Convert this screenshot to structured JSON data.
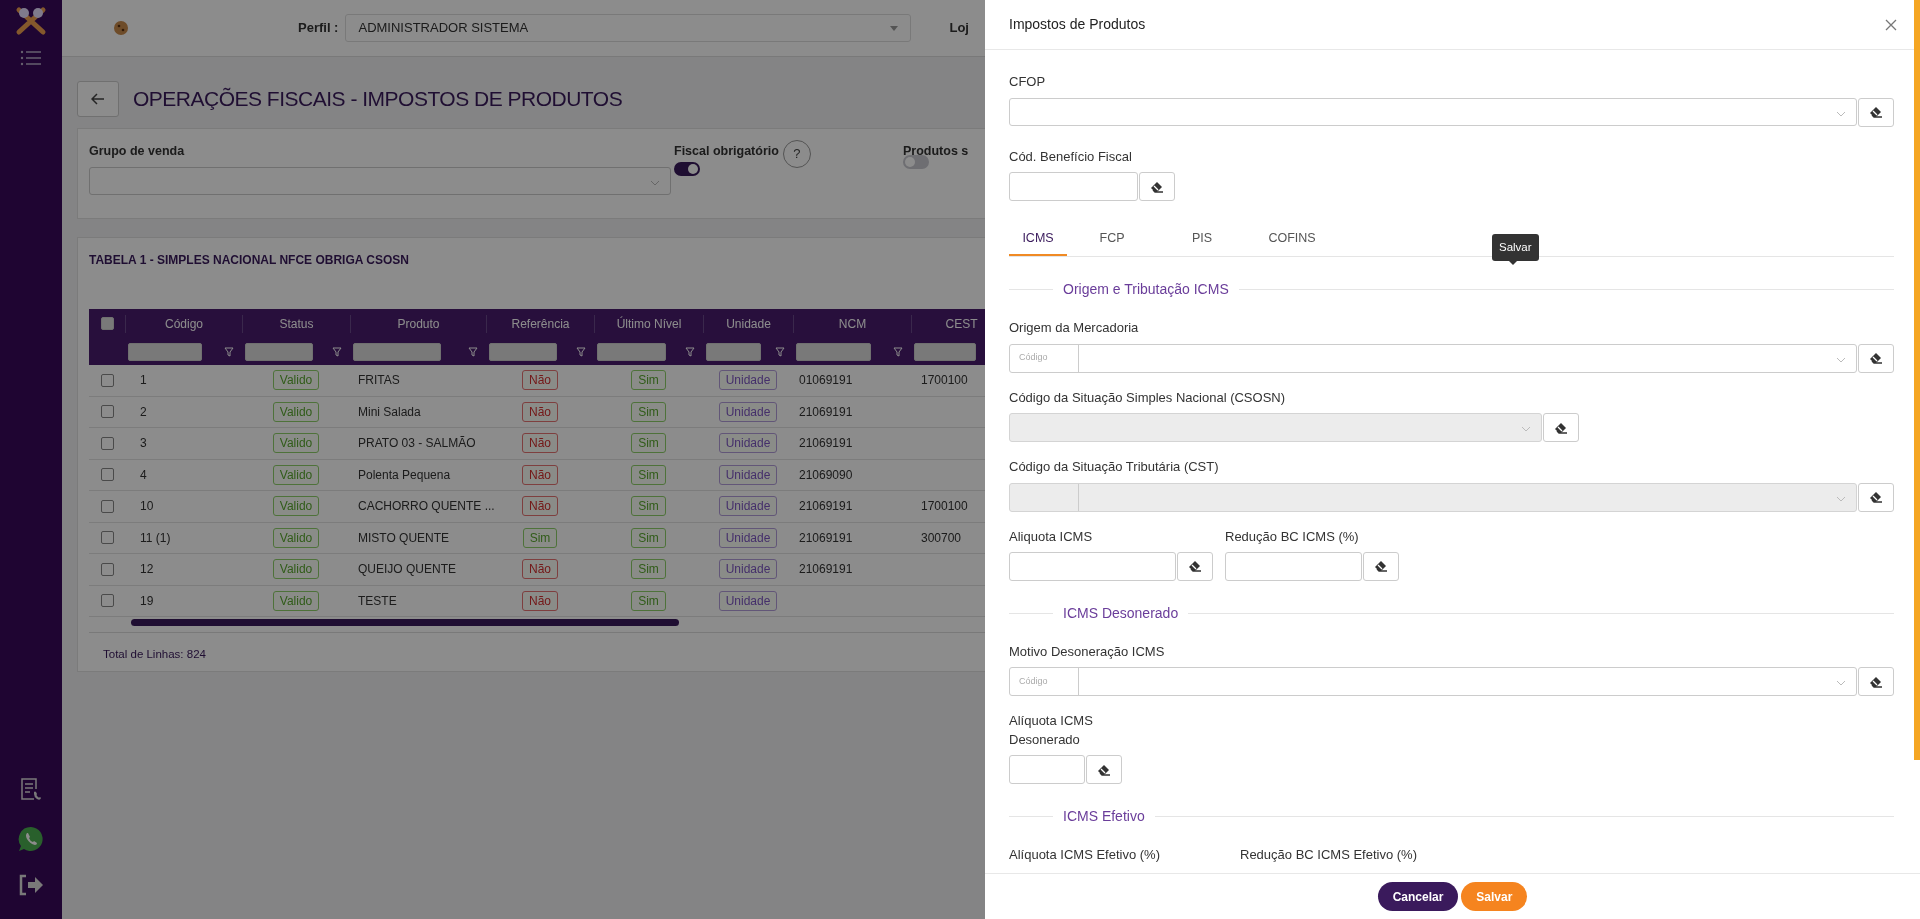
{
  "header": {
    "profile_label": "Perfil :",
    "profile_value": "ADMINISTRADOR SISTEMA",
    "store_label": "Loj"
  },
  "page": {
    "title": "OPERAÇÕES FISCAIS - IMPOSTOS DE PRODUTOS"
  },
  "filters": [
    {
      "kind": "select",
      "label": "Grupo de venda"
    },
    {
      "kind": "toggle",
      "label": "Fiscal obrigatório",
      "on": true,
      "help": "?"
    },
    {
      "kind": "toggle",
      "label": "Produtos s",
      "on": false
    }
  ],
  "table": {
    "title": "TABELA 1 - SIMPLES NACIONAL NFCE OBRIGA CSOSN",
    "header_checked": false,
    "columns": [
      "Código",
      "Status",
      "Produto",
      "Referência",
      "Último Nível",
      "Unidade",
      "NCM",
      "CEST"
    ],
    "rows": [
      {
        "checked": false,
        "codigo": "1",
        "status": "Valido",
        "produto": "FRITAS",
        "referencia": {
          "text": "Não",
          "positive": false
        },
        "ultimo_nivel": "Sim",
        "unidade": "Unidade",
        "ncm": "01069191",
        "cest": "1700100"
      },
      {
        "checked": false,
        "codigo": "2",
        "status": "Valido",
        "produto": "Mini Salada",
        "referencia": {
          "text": "Não",
          "positive": false
        },
        "ultimo_nivel": "Sim",
        "unidade": "Unidade",
        "ncm": "21069191",
        "cest": ""
      },
      {
        "checked": false,
        "codigo": "3",
        "status": "Valido",
        "produto": "PRATO 03 - SALMÃO",
        "referencia": {
          "text": "Não",
          "positive": false
        },
        "ultimo_nivel": "Sim",
        "unidade": "Unidade",
        "ncm": "21069191",
        "cest": ""
      },
      {
        "checked": false,
        "codigo": "4",
        "status": "Valido",
        "produto": "Polenta Pequena",
        "referencia": {
          "text": "Não",
          "positive": false
        },
        "ultimo_nivel": "Sim",
        "unidade": "Unidade",
        "ncm": "21069090",
        "cest": ""
      },
      {
        "checked": false,
        "codigo": "10",
        "status": "Valido",
        "produto": "CACHORRO QUENTE ...",
        "referencia": {
          "text": "Não",
          "positive": false
        },
        "ultimo_nivel": "Sim",
        "unidade": "Unidade",
        "ncm": "21069191",
        "cest": "1700100"
      },
      {
        "checked": false,
        "codigo": "11 (1)",
        "status": "Valido",
        "produto": "MISTO QUENTE",
        "referencia": {
          "text": "Sim",
          "positive": true
        },
        "ultimo_nivel": "Sim",
        "unidade": "Unidade",
        "ncm": "21069191",
        "cest": "300700"
      },
      {
        "checked": false,
        "codigo": "12",
        "status": "Valido",
        "produto": "QUEIJO QUENTE",
        "referencia": {
          "text": "Não",
          "positive": false
        },
        "ultimo_nivel": "Sim",
        "unidade": "Unidade",
        "ncm": "21069191",
        "cest": ""
      },
      {
        "checked": false,
        "codigo": "19",
        "status": "Valido",
        "produto": "TESTE",
        "referencia": {
          "text": "Não",
          "positive": false
        },
        "ultimo_nivel": "Sim",
        "unidade": "Unidade",
        "ncm": "",
        "cest": ""
      }
    ],
    "total": "Total de Linhas: 824"
  },
  "drawer": {
    "title": "Impostos de Produtos",
    "cfop": {
      "label": "CFOP"
    },
    "beneficio": {
      "label": "Cód. Benefício Fiscal"
    },
    "tabs": [
      {
        "label": "ICMS",
        "selected": true
      },
      {
        "label": "FCP",
        "selected": false
      },
      {
        "label": "PIS",
        "selected": false
      },
      {
        "label": "COFINS",
        "selected": false
      }
    ],
    "tooltip": "Salvar",
    "sections": [
      {
        "title": "Origem e Tributação ICMS",
        "fields": [
          {
            "kind": "code-select",
            "label": "Origem da Mercadoria",
            "code_placeholder": "Código",
            "disabled": false
          },
          {
            "kind": "select",
            "label": "Código da Situação Simples Nacional (CSOSN)",
            "disabled": true
          },
          {
            "kind": "code-select",
            "label": "Código da Situação Tributária (CST)",
            "disabled": true
          },
          {
            "kind": "inputs",
            "items": [
              {
                "kind": "input",
                "label": "Aliquota ICMS"
              },
              {
                "kind": "input",
                "label": "Redução BC ICMS (%)"
              }
            ]
          }
        ]
      },
      {
        "title": "ICMS Desonerado",
        "fields": [
          {
            "kind": "code-select",
            "label": "Motivo Desoneração ICMS",
            "code_placeholder": "Código",
            "disabled": false
          },
          {
            "kind": "inputs",
            "items": [
              {
                "kind": "compact-input",
                "label": "Alíquota ICMS Desonerado"
              }
            ]
          }
        ]
      },
      {
        "title": "ICMS Efetivo",
        "fields": [
          {
            "kind": "inputs",
            "items": [
              {
                "kind": "caption",
                "label": "Alíquota ICMS Efetivo (%)"
              },
              {
                "kind": "caption",
                "label": "Redução BC ICMS Efetivo (%)"
              }
            ]
          }
        ]
      }
    ],
    "buttons": [
      {
        "kind": "secondary",
        "label": "Cancelar"
      },
      {
        "kind": "primary",
        "label": "Salvar"
      }
    ]
  }
}
